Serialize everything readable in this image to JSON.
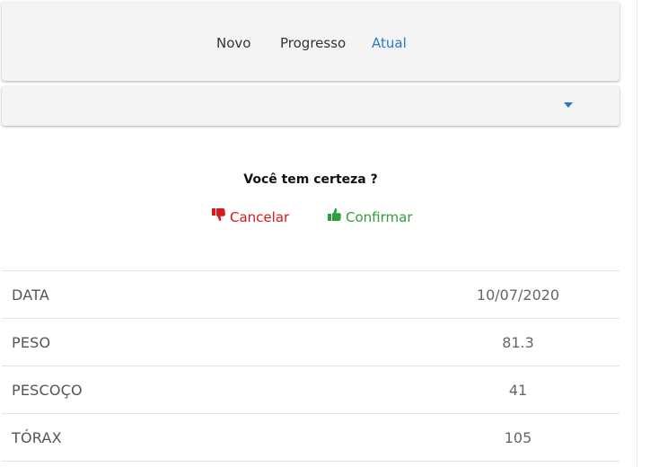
{
  "nav": {
    "tabs": [
      {
        "label": "Novo"
      },
      {
        "label": "Progresso"
      },
      {
        "label": "Atual"
      }
    ],
    "active_tab": "Atual"
  },
  "select": {
    "value": "",
    "caret_color": "#2b79c2"
  },
  "confirm_dialog": {
    "title": "Você tem certeza ?",
    "cancel_label": "Cancelar",
    "cancel_icon": "thumbs-down-icon",
    "cancel_color": "#d9191b",
    "confirm_label": "Confirmar",
    "confirm_icon": "thumbs-up-icon",
    "confirm_color": "#2f9e3c"
  },
  "table": {
    "rows": [
      {
        "label": "DATA",
        "value": "10/07/2020"
      },
      {
        "label": "PESO",
        "value": "81.3"
      },
      {
        "label": "PESCOÇO",
        "value": "41"
      },
      {
        "label": "TÓRAX",
        "value": "105"
      }
    ]
  }
}
